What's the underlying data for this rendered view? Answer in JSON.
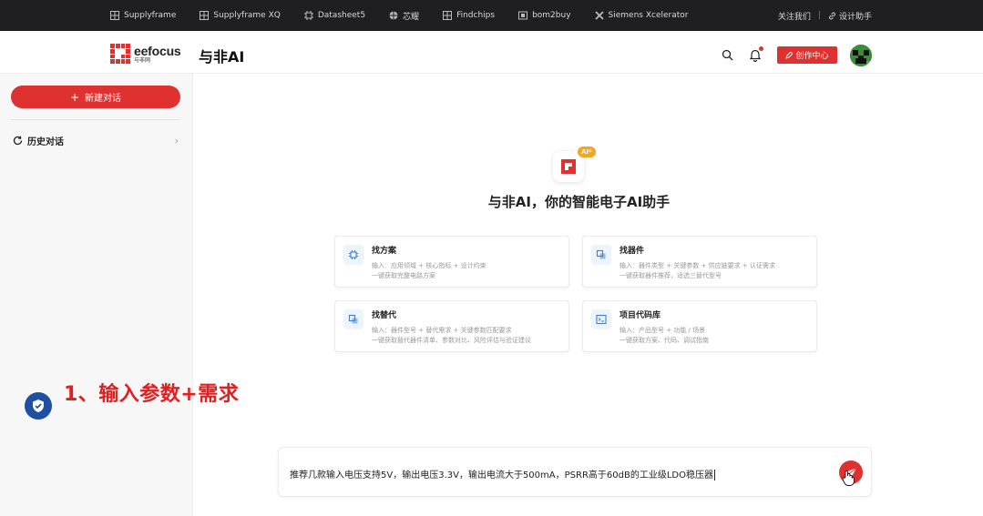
{
  "topbar": {
    "links": [
      {
        "label": "Supplyframe",
        "icon": "grid-icon"
      },
      {
        "label": "Supplyframe XQ",
        "icon": "grid-icon"
      },
      {
        "label": "Datasheet5",
        "icon": "chip-icon"
      },
      {
        "label": "芯耀",
        "icon": "globe-icon"
      },
      {
        "label": "Findchips",
        "icon": "grid-icon"
      },
      {
        "label": "bom2buy",
        "icon": "box-icon"
      },
      {
        "label": "Siemens Xcelerator",
        "icon": "x-icon"
      }
    ],
    "contact": "关注我们",
    "separator": "|",
    "assistant": "设计助手"
  },
  "header": {
    "logo_en": "eefocus",
    "logo_cn": "与非网",
    "title": "与非AI",
    "create_label": "创作中心"
  },
  "sidebar": {
    "new_chat_label": "新建对话",
    "history_label": "历史对话"
  },
  "main": {
    "ai_badge": "AI*",
    "title": "与非AI，你的智能电子AI助手",
    "cards": [
      {
        "title": "找方案",
        "desc1": "输入：应用领域 + 核心指标 + 设计约束",
        "desc2": "一键获取完整电路方案",
        "icon": "chip-icon"
      },
      {
        "title": "找器件",
        "desc1": "输入：器件类型 + 关键参数 + 供应链要求 + 认证需求",
        "desc2": "一键获取器件推荐，适选三替代型号",
        "icon": "copy-icon"
      },
      {
        "title": "找替代",
        "desc1": "输入：器件型号 + 替代需求 + 关键参数匹配要求",
        "desc2": "一键获取替代器件清单、参数对比、风险评估与验证建议",
        "icon": "copy-icon"
      },
      {
        "title": "项目代码库",
        "desc1": "输入：产品型号 + 功能 / 场景",
        "desc2": "一键获取方案、代码、调试指南",
        "icon": "terminal-icon"
      }
    ],
    "overlay_text": "1、输入参数+需求",
    "input_value": "推荐几款输入电压支持5V，输出电压3.3V，输出电流大于500mA，PSRR高于60dB的工业级LDO稳压器"
  },
  "colors": {
    "accent": "#e03131",
    "topbar_bg": "#1f1f22",
    "badge": "#f5a524"
  }
}
